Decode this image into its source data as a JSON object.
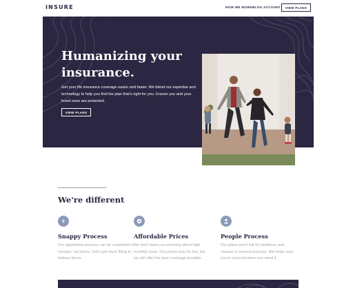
{
  "header": {
    "logo": "INSURE",
    "nav": [
      "HOW WE WORK",
      "BLOG",
      "ACCOUNT"
    ],
    "cta": "VIEW PLANS"
  },
  "hero": {
    "title": "Humanizing your insurance.",
    "text": "Get your life insurance coverage easier and faster. We blend our expertise and technology to help you find the plan that's right for you. Ensure you and your loved ones are protected.",
    "cta": "VIEW PLANS"
  },
  "different": {
    "title": "We're different",
    "features": [
      {
        "icon": "snappy-icon",
        "title": "Snappy Process",
        "text": "Our application process can be completed in minutes, not hours. Don't get stuck filling in tedious forms."
      },
      {
        "icon": "affordable-icon",
        "title": "Affordable Prices",
        "text": "We don't want you worrying about high monthly costs. Our prices may be low, but we still offer the best coverage possible."
      },
      {
        "icon": "people-icon",
        "title": "People Process",
        "text": "Our plans aren't full of conditions and clauses to prevent payouts. We make sure you're covered when you need it."
      }
    ]
  },
  "colors": {
    "primary": "#2b2641",
    "icon_bg": "#8c9ab8",
    "muted_text": "#a7a3b1"
  }
}
